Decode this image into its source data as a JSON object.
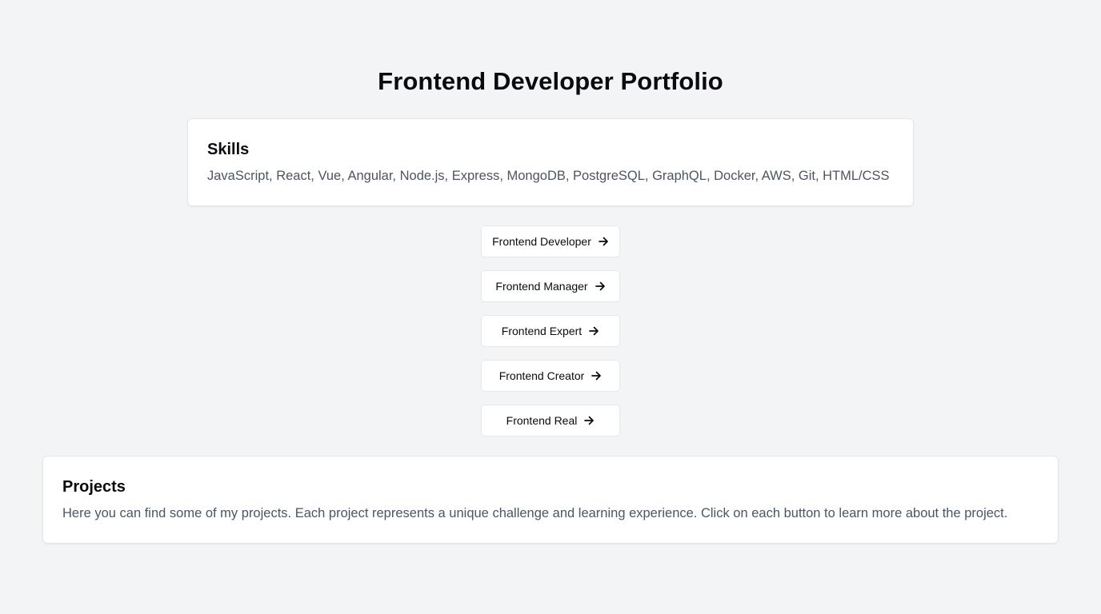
{
  "page": {
    "title": "Frontend Developer Portfolio"
  },
  "skills": {
    "heading": "Skills",
    "text": "JavaScript, React, Vue, Angular, Node.js, Express, MongoDB, PostgreSQL, GraphQL, Docker, AWS, Git, HTML/CSS"
  },
  "project_buttons": [
    {
      "label": "Frontend Developer",
      "icon": "arrow-right-icon"
    },
    {
      "label": "Frontend Manager",
      "icon": "arrow-right-icon"
    },
    {
      "label": "Frontend Expert",
      "icon": "arrow-right-icon"
    },
    {
      "label": "Frontend Creator",
      "icon": "arrow-right-icon"
    },
    {
      "label": "Frontend Real",
      "icon": "arrow-right-icon"
    }
  ],
  "projects": {
    "heading": "Projects",
    "text": "Here you can find some of my projects. Each project represents a unique challenge and learning experience. Click on each button to learn more about the project."
  },
  "colors": {
    "background": "#f3f4f6",
    "card": "#ffffff",
    "border": "#e5e7eb",
    "text_primary": "#0b0b0f",
    "text_secondary": "#4b5563"
  }
}
